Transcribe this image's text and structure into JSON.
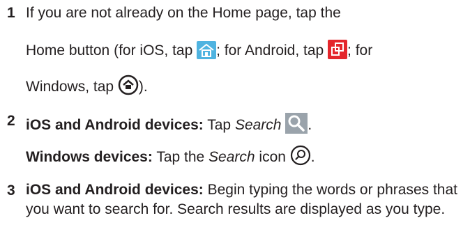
{
  "steps": [
    {
      "number": "1",
      "line1": "If you are not already on the Home page, tap the",
      "line2_a": "Home button (for iOS, tap ",
      "line2_b": "; for Android, tap ",
      "line2_c": "; for",
      "line3_a": "Windows, tap ",
      "line3_b": ")."
    },
    {
      "number": "2",
      "ios_bold": "iOS and Android devices:",
      "ios_text": " Tap ",
      "ios_italic": "Search",
      "ios_end": ".",
      "win_bold": "Windows devices:",
      "win_text": " Tap the ",
      "win_italic": "Search",
      "win_text2": " icon ",
      "win_end": "."
    },
    {
      "number": "3",
      "bold": "iOS and Android devices:",
      "text": " Begin typing the words or phrases that you want to search for. Search results are displayed as you type."
    }
  ],
  "icons": {
    "ios_home": "home-icon",
    "android_home": "android-home-icon",
    "windows_home": "windows-home-icon",
    "ios_search": "search-icon",
    "windows_search": "windows-search-icon"
  },
  "colors": {
    "text": "#231f20",
    "ios_home_icon": "#4fb3e0",
    "android_home_icon": "#e4262b",
    "search_icon_bg": "#9aa3ab"
  }
}
